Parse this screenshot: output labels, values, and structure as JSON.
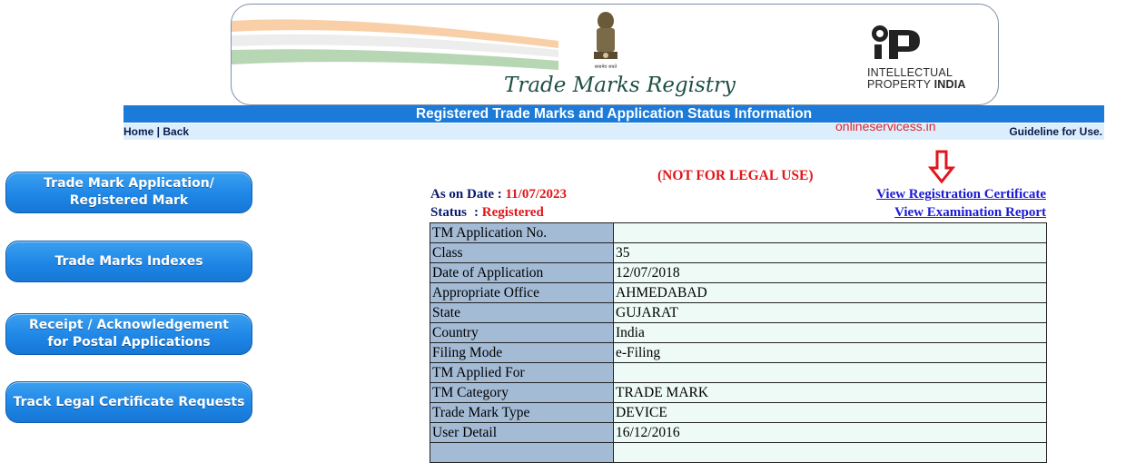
{
  "header": {
    "registry_title": "Trade Marks Registry",
    "emblem_caption": "सत्यमेव जयते",
    "ip_logo_line1": "INTELLECTUAL",
    "ip_logo_line2_prefix": "PROPERTY ",
    "ip_logo_line2_bold": "INDIA"
  },
  "title_bar": "Registered Trade Marks and Application Status Information",
  "nav": {
    "home": "Home",
    "separator": " | ",
    "back": "Back",
    "guideline": "Guideline for Use."
  },
  "watermark": "onlineservicess.in",
  "sidebar": {
    "buttons": [
      {
        "line1": "Trade Mark Application/",
        "line2": "Registered Mark"
      },
      {
        "line1": "Trade Marks Indexes",
        "line2": ""
      },
      {
        "line1": "Receipt / Acknowledgement",
        "line2": "for Postal Applications"
      },
      {
        "line1": "Track Legal Certificate Requests",
        "line2": ""
      }
    ]
  },
  "main": {
    "legal_note": "(NOT FOR LEGAL USE)",
    "as_on_label": "As on Date : ",
    "as_on_value": "11/07/2023",
    "status_label": "Status",
    "status_sep": ": ",
    "status_value": "Registered",
    "view_certificate": "View Registration Certificate",
    "view_report": "View Examination Report",
    "arrow_color": "#e0161a"
  },
  "details": [
    {
      "label": "TM Application No.",
      "value": ""
    },
    {
      "label": "Class",
      "value": "35"
    },
    {
      "label": "Date of Application",
      "value": "12/07/2018"
    },
    {
      "label": "Appropriate Office",
      "value": "AHMEDABAD"
    },
    {
      "label": "State",
      "value": "GUJARAT"
    },
    {
      "label": "Country",
      "value": "India"
    },
    {
      "label": "Filing Mode",
      "value": "e-Filing"
    },
    {
      "label": "TM Applied For",
      "value": ""
    },
    {
      "label": "TM Category",
      "value": "TRADE MARK"
    },
    {
      "label": "Trade Mark Type",
      "value": "DEVICE"
    },
    {
      "label": "User Detail",
      "value": "16/12/2016"
    },
    {
      "label": "",
      "value": ""
    }
  ],
  "colors": {
    "title_bar": "#1c7ad8",
    "nav_bar": "#dceefc",
    "button": "#1f86e6",
    "label_cell": "#a4bbd6",
    "value_cell": "#eefaf6",
    "accent_red": "#e0161a"
  }
}
